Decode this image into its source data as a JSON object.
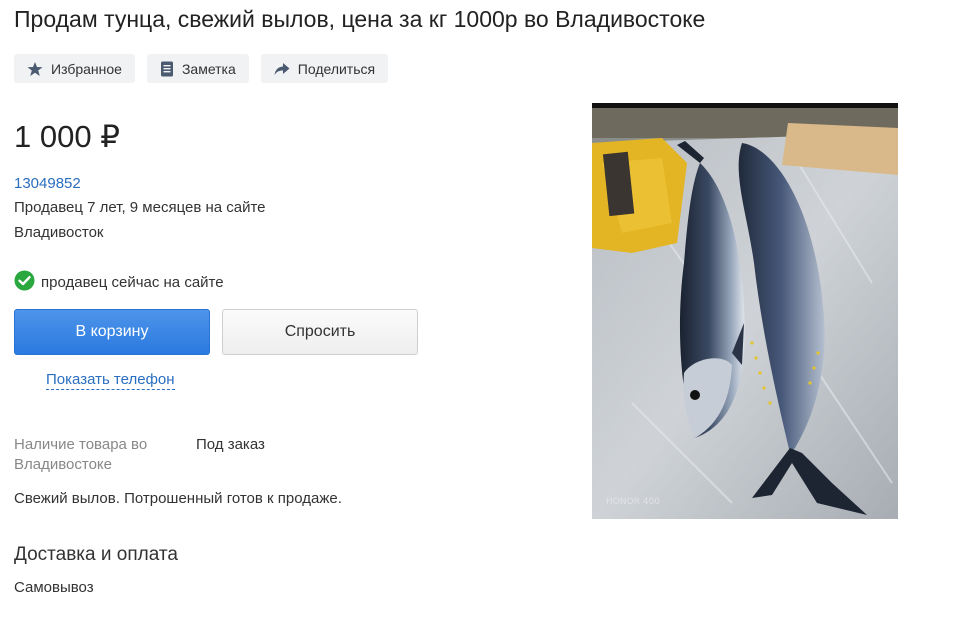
{
  "listing": {
    "title": "Продам тунца, свежий вылов, цена за кг 1000р во Владивостоке",
    "price": "1 000 ₽",
    "description": "Свежий вылов. Потрошенный готов к продаже."
  },
  "actions": {
    "favorites_label": "Избранное",
    "note_label": "Заметка",
    "share_label": "Поделиться",
    "icons": [
      "star-icon",
      "note-icon",
      "share-icon"
    ]
  },
  "seller": {
    "id": "13049852",
    "years": "Продавец 7 лет, 9 месяцев на сайте",
    "city": "Владивосток",
    "online_text": "продавец сейчас на сайте"
  },
  "buttons": {
    "cart_label": "В корзину",
    "ask_label": "Спросить",
    "phone_label": "Показать телефон"
  },
  "availability": {
    "label": "Наличие товара во Владивостоке",
    "value": "Под заказ"
  },
  "delivery": {
    "title": "Доставка и оплата",
    "value": "Самовывоз"
  },
  "photo": {
    "watermark": "HONOR 400"
  },
  "colors": {
    "accent_blue": "#2b7ae0",
    "link_blue": "#2a6ebf",
    "online_green": "#2aa73f"
  }
}
